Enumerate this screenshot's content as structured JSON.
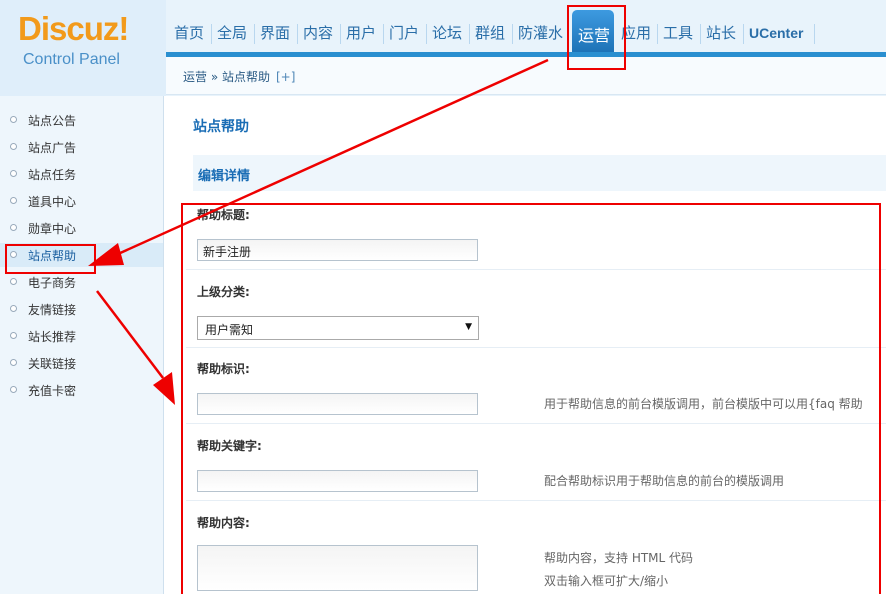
{
  "logo": {
    "main": "Discuz!",
    "sub": "Control Panel"
  },
  "nav": {
    "items": [
      "首页",
      "全局",
      "界面",
      "内容",
      "用户",
      "门户",
      "论坛",
      "群组",
      "防灌水",
      "运营",
      "应用",
      "工具",
      "站长",
      "UCenter"
    ],
    "active": "运营"
  },
  "breadcrumb": {
    "path": "运营 » 站点帮助",
    "toggle": "[+]"
  },
  "sidebar": {
    "items": [
      "站点公告",
      "站点广告",
      "站点任务",
      "道具中心",
      "勋章中心",
      "站点帮助",
      "电子商务",
      "友情链接",
      "站长推荐",
      "关联链接",
      "充值卡密"
    ],
    "active": "站点帮助"
  },
  "main": {
    "title": "站点帮助",
    "section": "编辑详情",
    "fields": {
      "help_title": {
        "label": "帮助标题:",
        "value": "新手注册"
      },
      "parent_category": {
        "label": "上级分类:",
        "value": "用户需知"
      },
      "help_id": {
        "label": "帮助标识:",
        "value": "",
        "hint": "用于帮助信息的前台模版调用，前台模版中可以用{faq 帮助"
      },
      "help_keyword": {
        "label": "帮助关键字:",
        "value": "",
        "hint": "配合帮助标识用于帮助信息的前台的模版调用"
      },
      "help_content": {
        "label": "帮助内容:",
        "hint_line1": "帮助内容，支持 HTML 代码",
        "hint_line2": "双击输入框可扩大/缩小"
      }
    }
  },
  "colors": {
    "annotation": "#e00000",
    "accent": "#1a6db5",
    "logo": "#f29a1b"
  }
}
